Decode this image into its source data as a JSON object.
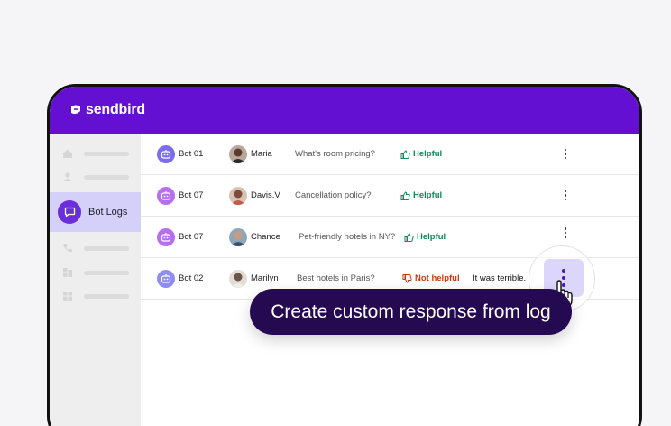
{
  "app": {
    "brand": "sendbird"
  },
  "sidebar": {
    "items": [
      {
        "icon": "home-icon"
      },
      {
        "icon": "users-icon"
      },
      {
        "icon": "chat-bubble-icon",
        "label": "Bot Logs",
        "active": true
      },
      {
        "icon": "phone-icon"
      },
      {
        "icon": "apps-icon"
      },
      {
        "icon": "grid-icon"
      }
    ]
  },
  "logs": [
    {
      "bot": "Bot 01",
      "bot_color": "#7b6cf0",
      "user": "Maria",
      "question": "What's room pricing?",
      "feedback": "Helpful",
      "feedback_type": "good",
      "comment": ""
    },
    {
      "bot": "Bot 07",
      "bot_color": "#b56ff0",
      "user": "Davis.V",
      "question": "Cancellation policy?",
      "feedback": "Helpful",
      "feedback_type": "good",
      "comment": ""
    },
    {
      "bot": "Bot 07",
      "bot_color": "#b56ff0",
      "user": "Chance",
      "question": "Pet-friendly hotels in NY?",
      "feedback": "Helpful",
      "feedback_type": "good",
      "comment": ""
    },
    {
      "bot": "Bot 02",
      "bot_color": "#8f8cf2",
      "user": "Marilyn",
      "question": "Best hotels in Paris?",
      "feedback": "Not helpful",
      "feedback_type": "bad",
      "comment": "It was terrible."
    }
  ],
  "tooltip": {
    "text": "Create custom response from log"
  },
  "colors": {
    "brand": "#6310d2",
    "tooltip_bg": "#250a52",
    "helpful": "#0f8a5b",
    "not_helpful": "#c93a14"
  }
}
